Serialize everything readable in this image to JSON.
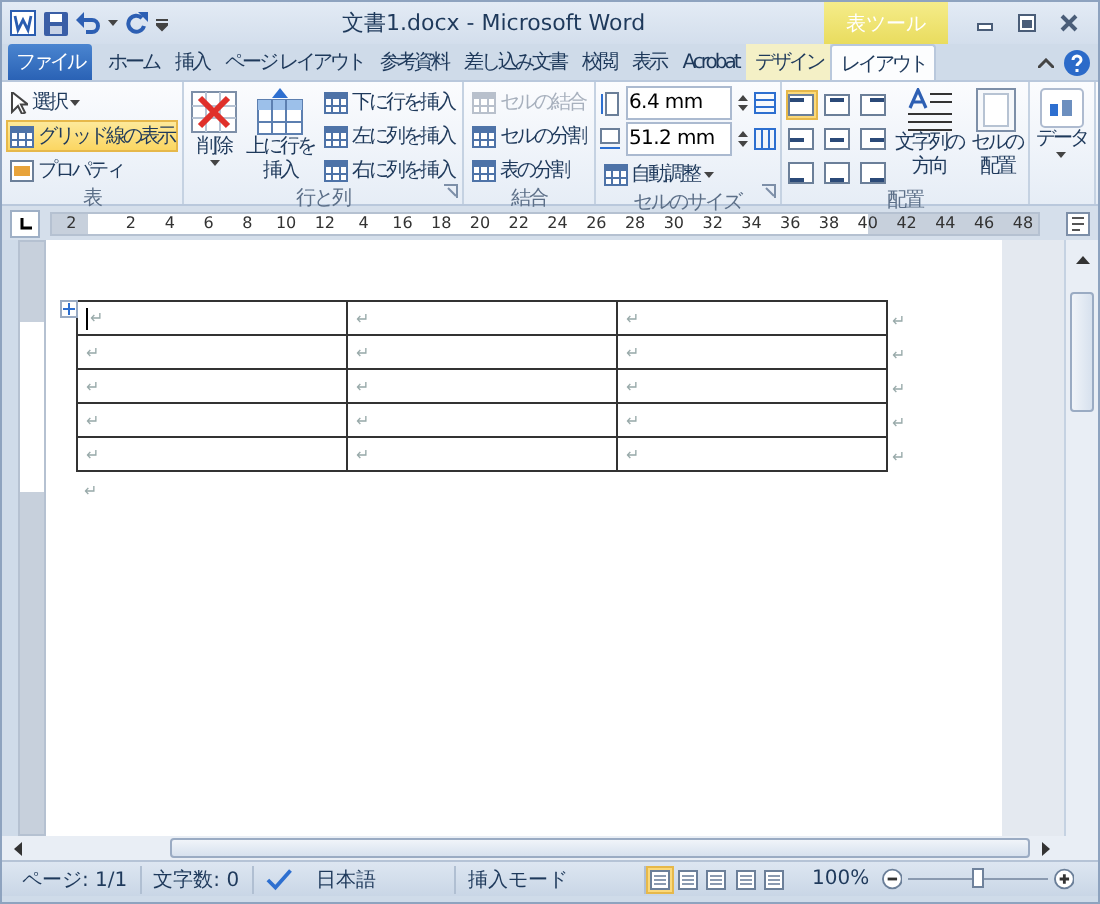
{
  "title_bar": {
    "title": "文書1.docx - Microsoft Word",
    "context_header": "表ツール"
  },
  "tabs": [
    {
      "label": "ファイル",
      "kind": "file",
      "selected": false
    },
    {
      "label": "ホーム",
      "kind": "normal",
      "selected": false
    },
    {
      "label": "挿入",
      "kind": "normal",
      "selected": false
    },
    {
      "label": "ページ レイアウト",
      "kind": "normal",
      "selected": false
    },
    {
      "label": "参考資料",
      "kind": "normal",
      "selected": false
    },
    {
      "label": "差し込み文書",
      "kind": "normal",
      "selected": false
    },
    {
      "label": "校閲",
      "kind": "normal",
      "selected": false
    },
    {
      "label": "表示",
      "kind": "normal",
      "selected": false
    },
    {
      "label": "Acrobat",
      "kind": "normal",
      "selected": false
    },
    {
      "label": "デザイン",
      "kind": "context",
      "selected": false
    },
    {
      "label": "レイアウト",
      "kind": "context",
      "selected": true
    }
  ],
  "ribbon": {
    "table": {
      "label": "表",
      "select": "選択",
      "gridlines": {
        "label": "グリッド線の表示",
        "selected": true
      },
      "properties": "プロパティ"
    },
    "rows_columns": {
      "label": "行と列",
      "delete": "削除",
      "insert_above": [
        "上に行を",
        "挿入"
      ],
      "insert_below": "下に行を挿入",
      "insert_left": "左に列を挿入",
      "insert_right": "右に列を挿入"
    },
    "merge": {
      "label": "結合",
      "items": [
        {
          "label": "セルの結合",
          "disabled": true
        },
        {
          "label": "セルの分割",
          "disabled": false
        },
        {
          "label": "表の分割",
          "disabled": false
        }
      ]
    },
    "cell_size": {
      "label": "セルのサイズ",
      "height": "6.4 mm",
      "width": "51.2 mm",
      "autofit": "自動調整"
    },
    "alignment": {
      "label": "配置",
      "buttons": [
        {
          "selected": true
        },
        {
          "selected": false
        },
        {
          "selected": false
        },
        {
          "selected": false
        },
        {
          "selected": false
        },
        {
          "selected": false
        },
        {
          "selected": false
        },
        {
          "selected": false
        },
        {
          "selected": false
        }
      ],
      "direction": [
        "文字列の",
        "方向"
      ],
      "margins": [
        "セルの",
        "配置"
      ]
    },
    "data": {
      "label": "データ"
    }
  },
  "ruler": [
    "2",
    "2",
    "4",
    "6",
    "8",
    "10",
    "12",
    "4",
    "16",
    "18",
    "20",
    "22",
    "24",
    "26",
    "28",
    "30",
    "32",
    "34",
    "36",
    "38",
    "40",
    "42",
    "44",
    "46",
    "48"
  ],
  "document": {
    "rows": [
      [
        "↵",
        "↵",
        "↵"
      ],
      [
        "↵",
        "↵",
        "↵"
      ],
      [
        "↵",
        "↵",
        "↵"
      ],
      [
        "↵",
        "↵",
        "↵"
      ],
      [
        "↵",
        "↵",
        "↵"
      ]
    ],
    "row_end_mark": "↵",
    "paragraph_mark": "↵"
  },
  "status_bar": {
    "page": "ページ: 1/1",
    "words": "文字数: 0",
    "language": "日本語",
    "mode": "挿入モード",
    "views": [
      {
        "selected": true
      },
      {
        "selected": false
      },
      {
        "selected": false
      },
      {
        "selected": false
      },
      {
        "selected": false
      }
    ],
    "zoom": "100%",
    "zoom_level": {
      "level": 0.5
    }
  }
}
